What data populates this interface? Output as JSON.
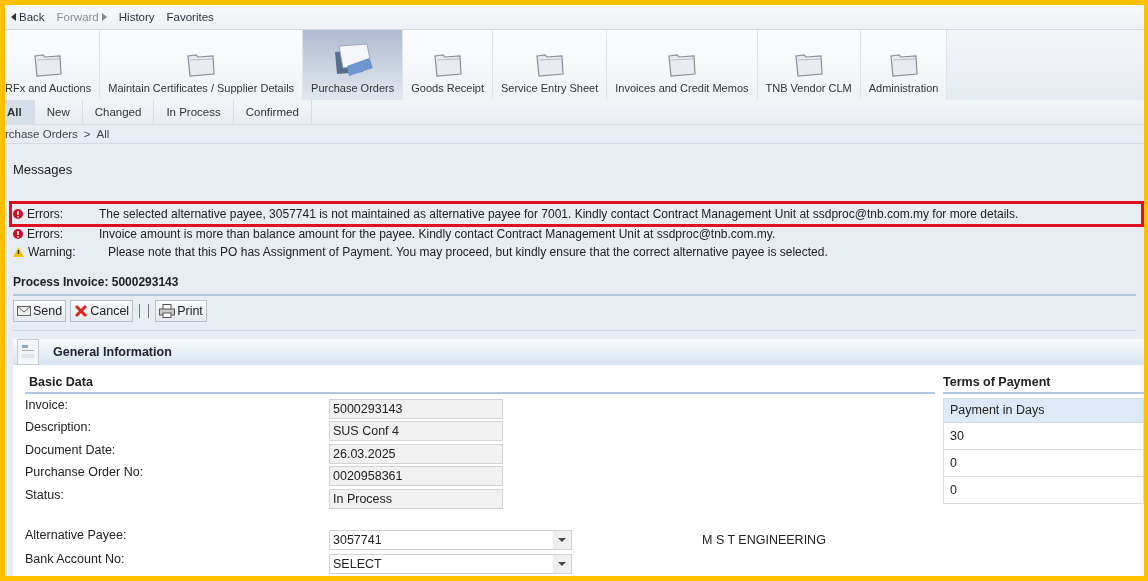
{
  "nav": [
    {
      "kind": "back",
      "label": "Back",
      "disabled": false
    },
    {
      "kind": "forward",
      "label": "Forward",
      "disabled": true
    },
    {
      "kind": "link",
      "label": "History",
      "disabled": false
    },
    {
      "kind": "link",
      "label": "Favorites",
      "disabled": false
    }
  ],
  "tabs": [
    {
      "label": "RFx and Auctions",
      "selected": false
    },
    {
      "label": "Maintain Certificates / Supplier Details",
      "selected": false
    },
    {
      "label": "Purchase Orders",
      "selected": true
    },
    {
      "label": "Goods Receipt",
      "selected": false
    },
    {
      "label": "Service Entry Sheet",
      "selected": false
    },
    {
      "label": "Invoices and Credit Memos",
      "selected": false
    },
    {
      "label": "TNB Vendor CLM",
      "selected": false
    },
    {
      "label": "Administration",
      "selected": false
    }
  ],
  "subtabs": [
    {
      "label": "All",
      "selected": true
    },
    {
      "label": "New",
      "selected": false
    },
    {
      "label": "Changed",
      "selected": false
    },
    {
      "label": "In Process",
      "selected": false
    },
    {
      "label": "Confirmed",
      "selected": false
    }
  ],
  "breadcrumb": {
    "path": "rchase Orders",
    "separator": ">",
    "current": "All"
  },
  "messages_title": "Messages",
  "messages": [
    {
      "kind": "error",
      "label": "Errors:",
      "text": "The selected alternative payee, 3057741 is not maintained as alternative payee for 7001. Kindly contact Contract Management Unit at ssdproc@tnb.com.my for more details.",
      "highlighted": true
    },
    {
      "kind": "error",
      "label": "Errors:",
      "text": "Invoice amount is more than balance amount for the payee. Kindly contact Contract Management Unit at ssdproc@tnb.com.my.",
      "highlighted": false
    },
    {
      "kind": "warning",
      "label": "Warning:",
      "text": "Please note that this PO has Assignment of Payment. You may proceed, but kindly ensure that the correct alternative payee is selected.",
      "highlighted": false
    }
  ],
  "process_title": "Process Invoice: 5000293143",
  "toolbar": [
    {
      "kind": "send",
      "label": "Send"
    },
    {
      "kind": "cancel",
      "label": "Cancel"
    },
    {
      "kind": "print",
      "label": "Print"
    }
  ],
  "section_title": "General Information",
  "basic_data": {
    "title": "Basic Data",
    "fields": [
      {
        "label": "Invoice:",
        "value": "5000293143"
      },
      {
        "label": "Description:",
        "value": "SUS Conf 4"
      },
      {
        "label": "Document Date:",
        "value": "26.03.2025"
      },
      {
        "label": "Purchanse Order No:",
        "value": "0020958361"
      },
      {
        "label": "Status:",
        "value": "In Process"
      }
    ]
  },
  "payee_fields": [
    {
      "label": "Alternative Payee:",
      "value": "3057741",
      "name": "M S T ENGINEERING"
    },
    {
      "label": "Bank Account No:",
      "value": "SELECT"
    }
  ],
  "terms": {
    "title": "Terms of Payment",
    "header": "Payment in Days",
    "rows": [
      "30",
      "0",
      "0"
    ]
  }
}
